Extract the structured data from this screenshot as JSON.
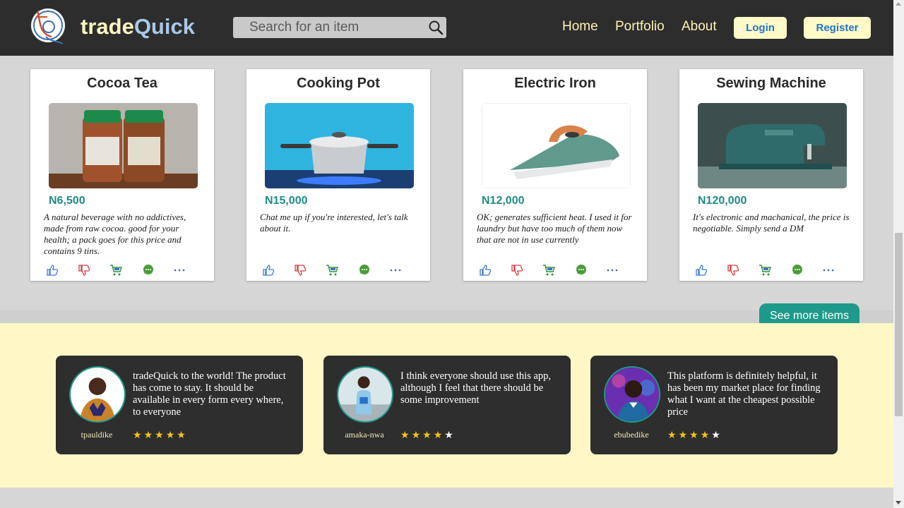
{
  "header": {
    "brand_part1": "trade",
    "brand_part2": "Quick",
    "search_placeholder": "Search for an item",
    "nav": [
      "Home",
      "Portfolio",
      "About"
    ],
    "login_label": "Login",
    "register_label": "Register"
  },
  "products": [
    {
      "title": "Cocoa Tea",
      "price": "N6,500",
      "description": "A natural beverage with no addictives, made from raw cocoa. good for your health; a pack goes for this price and contains 9 tins."
    },
    {
      "title": "Cooking Pot",
      "price": "N15,000",
      "description": "Chat me up if you're interested, let's talk about it."
    },
    {
      "title": "Electric Iron",
      "price": "N12,000",
      "description": "OK; generates sufficient heat. I used it for laundry but have too much of them now that are not in use currently"
    },
    {
      "title": "Sewing Machine",
      "price": "N120,000",
      "description": "It's electronic and machanical, the price is negotiable. Simply send a DM"
    }
  ],
  "see_more_label": "See more items",
  "testimonials": [
    {
      "text": "tradeQuick to the world! The product has come to stay. It should be available in every form every where, to everyone",
      "name": "tpauldike",
      "rating": 5
    },
    {
      "text": "I think everyone should use this app, although I feel that there should be some improvement",
      "name": "amaka-nwa",
      "rating": 4
    },
    {
      "text": "This platform is definitely helpful, it has been my market place for finding what I want at the cheapest possible price",
      "name": "ebubedike",
      "rating": 4
    }
  ],
  "colors": {
    "header_bg": "#2d2d2d",
    "accent_teal": "#1f9a8a",
    "price_teal": "#1f8b84",
    "cream": "#fff8c6",
    "button_text_blue": "#1e74c9"
  }
}
